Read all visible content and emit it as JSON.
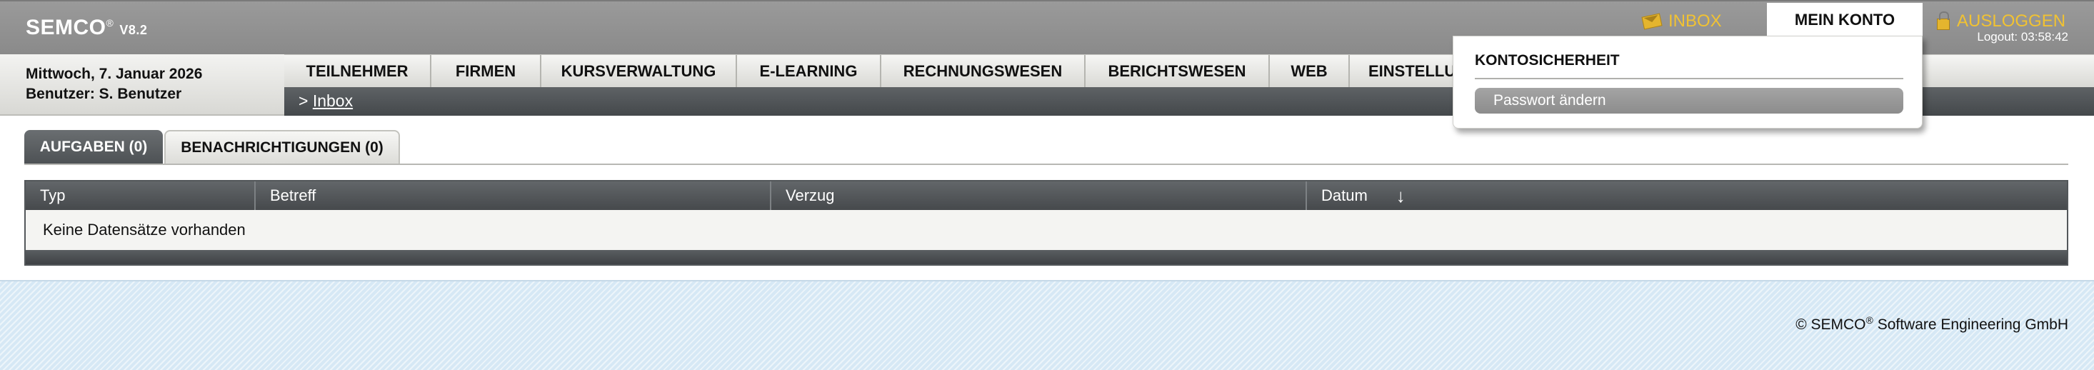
{
  "header": {
    "brand": "SEMCO",
    "brand_mark": "®",
    "version": "V8.2",
    "inbox_label": "INBOX",
    "inbox_icon": "mail-icon",
    "account_label": "MEIN KONTO",
    "logout_label": "AUSLOGGEN",
    "logout_icon": "lock-icon",
    "logout_timer": "Logout: 03:58:42",
    "accent_color": "#f1c232"
  },
  "info": {
    "date": "Mittwoch, 7. Januar 2026",
    "user": "Benutzer: S. Benutzer"
  },
  "nav": {
    "items": [
      {
        "label": "TEILNEHMER"
      },
      {
        "label": "FIRMEN"
      },
      {
        "label": "KURSVERWALTUNG"
      },
      {
        "label": "E-LEARNING"
      },
      {
        "label": "RECHNUNGSWESEN"
      },
      {
        "label": "BERICHTSWESEN"
      },
      {
        "label": "WEB"
      },
      {
        "label": "EINSTELLUNGEN"
      }
    ]
  },
  "breadcrumb": {
    "prefix": ">",
    "link": "Inbox"
  },
  "tabs": [
    {
      "label": "AUFGABEN (0)",
      "active": true
    },
    {
      "label": "BENACHRICHTIGUNGEN (0)",
      "active": false
    }
  ],
  "table": {
    "columns": [
      {
        "label": "Typ"
      },
      {
        "label": "Betreff"
      },
      {
        "label": "Verzug"
      },
      {
        "label": "Datum",
        "sort": "↓"
      }
    ],
    "empty_text": "Keine Datensätze vorhanden"
  },
  "dropdown": {
    "title": "KONTOSICHERHEIT",
    "items": [
      {
        "label": "Passwort ändern"
      }
    ]
  },
  "footer": {
    "copyright_prefix": "© SEMCO",
    "copyright_mark": "®",
    "copyright_suffix": " Software Engineering GmbH"
  }
}
